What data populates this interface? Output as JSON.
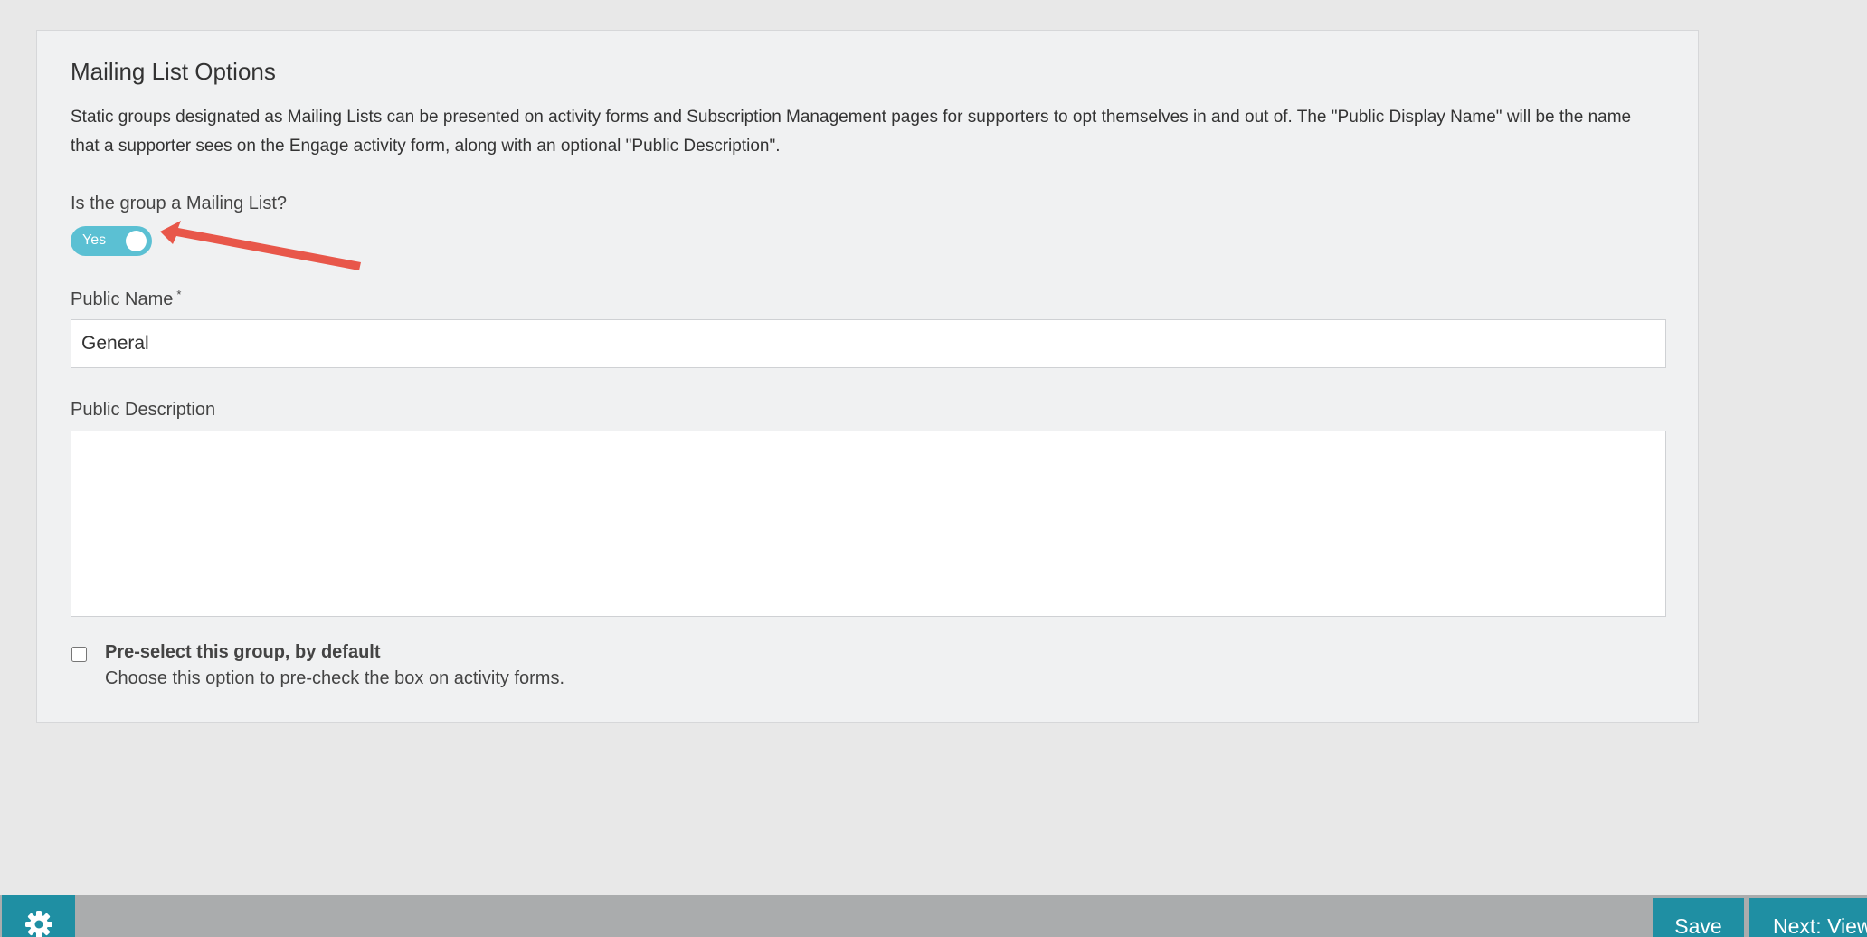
{
  "panel": {
    "title": "Mailing List Options",
    "description": "Static groups designated as Mailing Lists can be presented on activity forms and Subscription Management pages for supporters to opt themselves in and out of. The \"Public Display Name\" will be the name that a supporter sees on the Engage activity form, along with an optional \"Public Description\"."
  },
  "mailing_list_toggle": {
    "label": "Is the group a Mailing List?",
    "value_text": "Yes",
    "checked": true
  },
  "public_name": {
    "label": "Public Name",
    "required_mark": "*",
    "value": "General"
  },
  "public_description": {
    "label": "Public Description",
    "value": ""
  },
  "preselect": {
    "title": "Pre-select this group, by default",
    "help": "Choose this option to pre-check the box on activity forms.",
    "checked": false
  },
  "footer": {
    "settings_icon": "gear-icon",
    "save_label": "Save",
    "next_label": "Next: View"
  },
  "colors": {
    "accent": "#5bc0d3",
    "footer_button": "#1f8fa3",
    "annotation_arrow": "#e8574a"
  }
}
